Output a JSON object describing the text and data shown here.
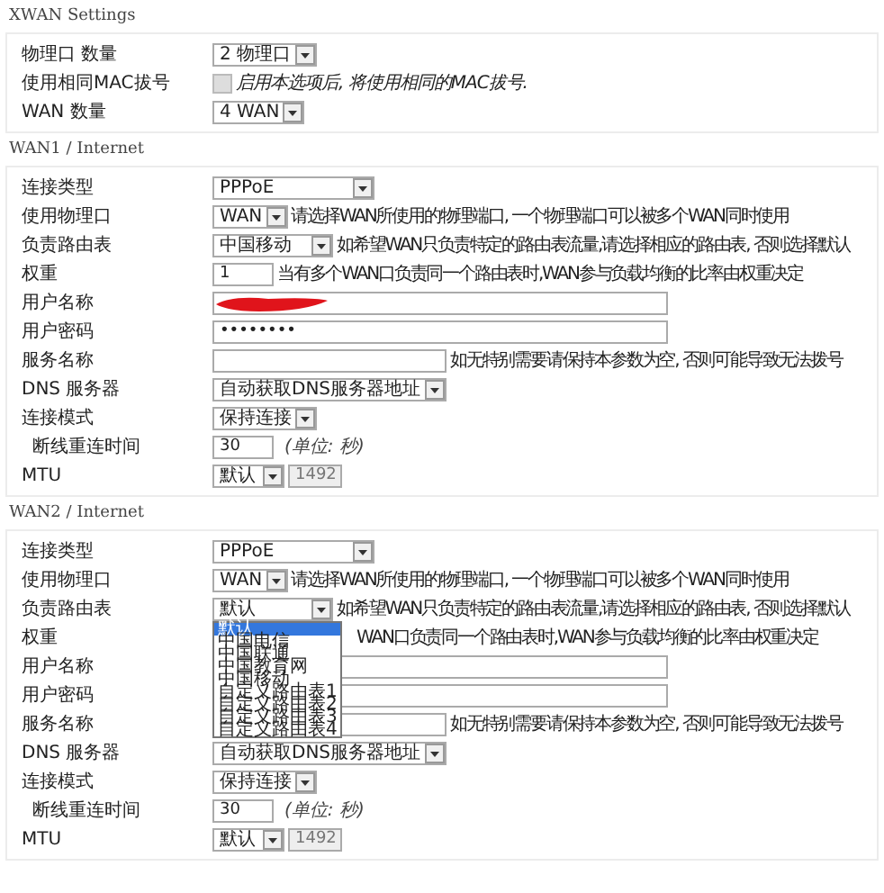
{
  "xwan": {
    "title": "XWAN Settings",
    "rows": [
      {
        "label": "物理口 数量",
        "kind": "select",
        "value": "2 物理口"
      },
      {
        "label": "使用相同MAC拔号",
        "kind": "checkbox",
        "checked": false,
        "note": "启用本选项后, 将使用相同的MAC拔号."
      },
      {
        "label": "WAN 数量",
        "kind": "select",
        "value": "4 WAN"
      }
    ]
  },
  "wans": [
    {
      "title": "WAN1 / Internet",
      "rows": [
        {
          "label": "连接类型",
          "kind": "select",
          "value": "PPPoE"
        },
        {
          "label": "使用物理口",
          "kind": "select",
          "value": "WAN",
          "hint": "请选择WAN所使用的物理端口, 一个物理端口可以被多个WAN同时使用"
        },
        {
          "label": "负责路由表",
          "kind": "select",
          "value": "中国移动",
          "hint": "如希望WAN只负责特定的路由表流量,请选择相应的路由表, 否则选择默认"
        },
        {
          "label": "权重",
          "kind": "input",
          "value": "1",
          "hint": "当有多个WAN口负责同一个路由表时,WAN参与负载均衡的比率由权重决定"
        },
        {
          "label": "用户名称",
          "kind": "input",
          "redacted": true
        },
        {
          "label": "用户密码",
          "kind": "input",
          "value": "••••••••"
        },
        {
          "label": "服务名称",
          "kind": "input",
          "hint": "如无特别需要请保持本参数为空, 否则可能导致无法拨号"
        },
        {
          "label": "DNS 服务器",
          "kind": "select",
          "value": "自动获取DNS服务器地址"
        },
        {
          "label": "连接模式",
          "kind": "select",
          "value": "保持连接"
        },
        {
          "label": "断线重连时间",
          "kind": "input",
          "sub": true,
          "value": "30",
          "unit": "(单位: 秒)"
        },
        {
          "label": "MTU",
          "kind": "select",
          "value": "默认",
          "extra": {
            "value": "1492",
            "disabled": true
          }
        }
      ]
    },
    {
      "title": "WAN2 / Internet",
      "rows": [
        {
          "label": "连接类型",
          "kind": "select",
          "value": "PPPoE"
        },
        {
          "label": "使用物理口",
          "kind": "select",
          "value": "WAN",
          "hint": "请选择WAN所使用的物理端口, 一个物理端口可以被多个WAN同时使用"
        },
        {
          "label": "负责路由表",
          "kind": "select",
          "value": "默认",
          "hint": "如希望WAN只负责特定的路由表流量,请选择相应的路由表, 否则选择默认",
          "open": true,
          "options": [
            {
              "label": "默认",
              "selected": true
            },
            {
              "label": "中国电信",
              "selected": false
            },
            {
              "label": "中国联通",
              "selected": false
            },
            {
              "label": "中国教育网",
              "selected": false
            },
            {
              "label": "中国移动",
              "selected": false
            },
            {
              "label": "自定义路由表1",
              "selected": false
            },
            {
              "label": "自定义路由表2",
              "selected": false
            },
            {
              "label": "自定义路由表3",
              "selected": false
            },
            {
              "label": "自定义路由表4",
              "selected": false
            }
          ]
        },
        {
          "label": "权重",
          "kind": "input",
          "hint": "WAN口负责同一个路由表时,WAN参与负载均衡的比率由权重决定"
        },
        {
          "label": "用户名称",
          "kind": "input"
        },
        {
          "label": "用户密码",
          "kind": "input"
        },
        {
          "label": "服务名称",
          "kind": "input",
          "hint": "如无特别需要请保持本参数为空, 否则可能导致无法拨号"
        },
        {
          "label": "DNS 服务器",
          "kind": "select",
          "value": "自动获取DNS服务器地址"
        },
        {
          "label": "连接模式",
          "kind": "select",
          "value": "保持连接"
        },
        {
          "label": "断线重连时间",
          "kind": "input",
          "sub": true,
          "value": "30",
          "unit": "(单位: 秒)"
        },
        {
          "label": "MTU",
          "kind": "select",
          "value": "默认",
          "extra": {
            "value": "1492",
            "disabled": true
          }
        }
      ]
    }
  ]
}
